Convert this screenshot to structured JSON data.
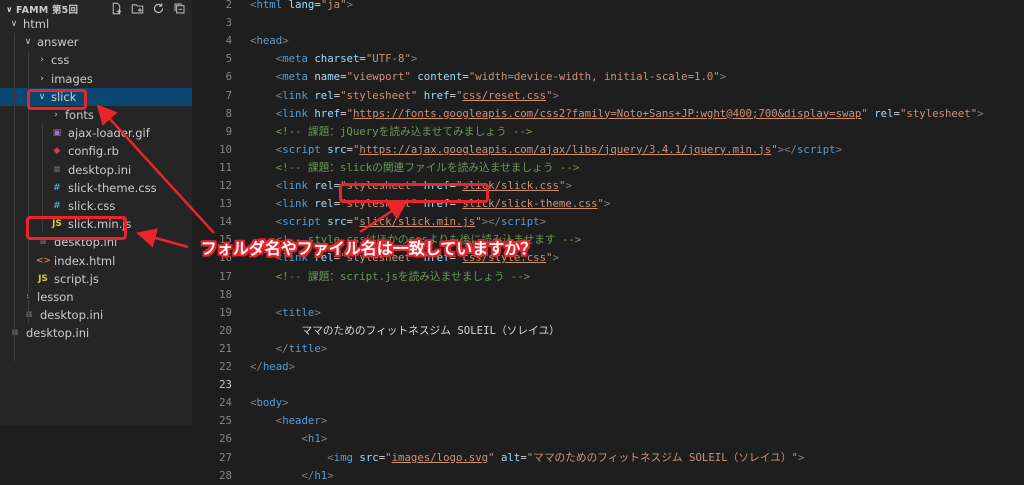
{
  "explorer": {
    "title": "FAMM 第5回",
    "items": [
      {
        "label": "html",
        "kind": "folder-open",
        "depth": 0
      },
      {
        "label": "answer",
        "kind": "folder-open",
        "depth": 1
      },
      {
        "label": "css",
        "kind": "folder-closed",
        "depth": 2
      },
      {
        "label": "images",
        "kind": "folder-closed",
        "depth": 2
      },
      {
        "label": "slick",
        "kind": "folder-open",
        "depth": 2,
        "selected": true
      },
      {
        "label": "fonts",
        "kind": "folder-closed",
        "depth": 3
      },
      {
        "label": "ajax-loader.gif",
        "kind": "image",
        "depth": 3
      },
      {
        "label": "config.rb",
        "kind": "ruby",
        "depth": 3
      },
      {
        "label": "desktop.ini",
        "kind": "settings",
        "depth": 3
      },
      {
        "label": "slick-theme.css",
        "kind": "css",
        "depth": 3
      },
      {
        "label": "slick.css",
        "kind": "css",
        "depth": 3
      },
      {
        "label": "slick.min.js",
        "kind": "js",
        "depth": 3
      },
      {
        "label": "desktop.ini",
        "kind": "settings",
        "depth": 2
      },
      {
        "label": "index.html",
        "kind": "html",
        "depth": 2
      },
      {
        "label": "script.js",
        "kind": "js",
        "depth": 2
      },
      {
        "label": "lesson",
        "kind": "folder-closed",
        "depth": 1
      },
      {
        "label": "desktop.ini",
        "kind": "settings",
        "depth": 1
      },
      {
        "label": "desktop.ini",
        "kind": "settings",
        "depth": 0
      }
    ]
  },
  "icons": {
    "css": "#",
    "js": "JS",
    "html": "<>",
    "settings": "≡",
    "ruby": "◆",
    "image": "▣",
    "chevron_open": "∨",
    "chevron_closed": "›"
  },
  "editor": {
    "lines": [
      {
        "num": "2",
        "tokens": [
          [
            "p",
            "<"
          ],
          [
            "tag",
            "html"
          ],
          [
            "t",
            " "
          ],
          [
            "attr",
            "lang"
          ],
          [
            "eq",
            "="
          ],
          [
            "val",
            "\"ja\""
          ],
          [
            "p",
            ">"
          ]
        ]
      },
      {
        "num": "3",
        "tokens": []
      },
      {
        "num": "4",
        "tokens": [
          [
            "p",
            "<"
          ],
          [
            "tag",
            "head"
          ],
          [
            "p",
            ">"
          ]
        ]
      },
      {
        "num": "5",
        "tokens": [
          [
            "t",
            "    "
          ],
          [
            "p",
            "<"
          ],
          [
            "tag",
            "meta"
          ],
          [
            "t",
            " "
          ],
          [
            "attr",
            "charset"
          ],
          [
            "eq",
            "="
          ],
          [
            "val",
            "\"UTF-8\""
          ],
          [
            "p",
            ">"
          ]
        ]
      },
      {
        "num": "6",
        "tokens": [
          [
            "t",
            "    "
          ],
          [
            "p",
            "<"
          ],
          [
            "tag",
            "meta"
          ],
          [
            "t",
            " "
          ],
          [
            "attr",
            "name"
          ],
          [
            "eq",
            "="
          ],
          [
            "val",
            "\"viewport\""
          ],
          [
            "t",
            " "
          ],
          [
            "attr",
            "content"
          ],
          [
            "eq",
            "="
          ],
          [
            "val",
            "\"width=device-width, initial-scale=1.0\""
          ],
          [
            "p",
            ">"
          ]
        ]
      },
      {
        "num": "7",
        "tokens": [
          [
            "t",
            "    "
          ],
          [
            "p",
            "<"
          ],
          [
            "tag",
            "link"
          ],
          [
            "t",
            " "
          ],
          [
            "attr",
            "rel"
          ],
          [
            "eq",
            "="
          ],
          [
            "val",
            "\"stylesheet\""
          ],
          [
            "t",
            " "
          ],
          [
            "attr",
            "href"
          ],
          [
            "eq",
            "="
          ],
          [
            "val",
            "\""
          ],
          [
            "link",
            "css/reset.css"
          ],
          [
            "val",
            "\""
          ],
          [
            "p",
            ">"
          ]
        ]
      },
      {
        "num": "8",
        "tokens": [
          [
            "t",
            "    "
          ],
          [
            "p",
            "<"
          ],
          [
            "tag",
            "link"
          ],
          [
            "t",
            " "
          ],
          [
            "attr",
            "href"
          ],
          [
            "eq",
            "="
          ],
          [
            "val",
            "\""
          ],
          [
            "link",
            "https://fonts.googleapis.com/css2?family=Noto+Sans+JP:wght@400;700&display=swap"
          ],
          [
            "val",
            "\""
          ],
          [
            "t",
            " "
          ],
          [
            "attr",
            "rel"
          ],
          [
            "eq",
            "="
          ],
          [
            "val",
            "\"stylesheet\""
          ],
          [
            "p",
            ">"
          ]
        ]
      },
      {
        "num": "9",
        "tokens": [
          [
            "t",
            "    "
          ],
          [
            "c",
            "<!-- 課題：jQueryを読み込ませてみましょう -->"
          ]
        ]
      },
      {
        "num": "10",
        "tokens": [
          [
            "t",
            "    "
          ],
          [
            "p",
            "<"
          ],
          [
            "tag",
            "script"
          ],
          [
            "t",
            " "
          ],
          [
            "attr",
            "src"
          ],
          [
            "eq",
            "="
          ],
          [
            "val",
            "\""
          ],
          [
            "link",
            "https://ajax.googleapis.com/ajax/libs/jquery/3.4.1/jquery.min.js"
          ],
          [
            "val",
            "\""
          ],
          [
            "p",
            "></"
          ],
          [
            "tag",
            "script"
          ],
          [
            "p",
            ">"
          ]
        ]
      },
      {
        "num": "11",
        "tokens": [
          [
            "t",
            "    "
          ],
          [
            "c",
            "<!-- 課題：slickの関連ファイルを読み込ませましょう -->"
          ]
        ]
      },
      {
        "num": "12",
        "tokens": [
          [
            "t",
            "    "
          ],
          [
            "p",
            "<"
          ],
          [
            "tag",
            "link"
          ],
          [
            "t",
            " "
          ],
          [
            "attr",
            "rel"
          ],
          [
            "eq",
            "="
          ],
          [
            "val",
            "\"stylesheet\""
          ],
          [
            "t",
            " "
          ],
          [
            "attr",
            "href"
          ],
          [
            "eq",
            "="
          ],
          [
            "val",
            "\""
          ],
          [
            "link",
            "slick/slick.css"
          ],
          [
            "val",
            "\""
          ],
          [
            "p",
            ">"
          ]
        ]
      },
      {
        "num": "13",
        "tokens": [
          [
            "t",
            "    "
          ],
          [
            "p",
            "<"
          ],
          [
            "tag",
            "link"
          ],
          [
            "t",
            " "
          ],
          [
            "attr",
            "rel"
          ],
          [
            "eq",
            "="
          ],
          [
            "val",
            "\"stylesheet\""
          ],
          [
            "t",
            " "
          ],
          [
            "attr",
            "href"
          ],
          [
            "eq",
            "="
          ],
          [
            "val",
            "\""
          ],
          [
            "link",
            "slick/slick-theme.css"
          ],
          [
            "val",
            "\""
          ],
          [
            "p",
            ">"
          ]
        ]
      },
      {
        "num": "14",
        "tokens": [
          [
            "t",
            "    "
          ],
          [
            "p",
            "<"
          ],
          [
            "tag",
            "script"
          ],
          [
            "t",
            " "
          ],
          [
            "attr",
            "src"
          ],
          [
            "eq",
            "="
          ],
          [
            "val",
            "\""
          ],
          [
            "link",
            "slick/slick.min.js"
          ],
          [
            "val",
            "\""
          ],
          [
            "p",
            "></"
          ],
          [
            "tag",
            "script"
          ],
          [
            "p",
            ">"
          ]
        ]
      },
      {
        "num": "15",
        "tokens": [
          [
            "t",
            "    "
          ],
          [
            "c",
            "<!-- style.cssはほかのcssよりも後に読み込ませます -->"
          ]
        ]
      },
      {
        "num": "16",
        "tokens": [
          [
            "t",
            "    "
          ],
          [
            "p",
            "<"
          ],
          [
            "tag",
            "link"
          ],
          [
            "t",
            " "
          ],
          [
            "attr",
            "rel"
          ],
          [
            "eq",
            "="
          ],
          [
            "val",
            "\"stylesheet\""
          ],
          [
            "t",
            " "
          ],
          [
            "attr",
            "href"
          ],
          [
            "eq",
            "="
          ],
          [
            "val",
            "\""
          ],
          [
            "link",
            "css/style.css"
          ],
          [
            "val",
            "\""
          ],
          [
            "p",
            ">"
          ]
        ]
      },
      {
        "num": "17",
        "tokens": [
          [
            "t",
            "    "
          ],
          [
            "c",
            "<!-- 課題：script.jsを読み込ませましょう -->"
          ]
        ]
      },
      {
        "num": "18",
        "tokens": []
      },
      {
        "num": "19",
        "tokens": [
          [
            "t",
            "    "
          ],
          [
            "p",
            "<"
          ],
          [
            "tag",
            "title"
          ],
          [
            "p",
            ">"
          ]
        ]
      },
      {
        "num": "20",
        "tokens": [
          [
            "t",
            "        "
          ],
          [
            "t",
            "ママのためのフィットネスジム SOLEIL（ソレイユ）"
          ]
        ]
      },
      {
        "num": "21",
        "tokens": [
          [
            "t",
            "    "
          ],
          [
            "p",
            "</"
          ],
          [
            "tag",
            "title"
          ],
          [
            "p",
            ">"
          ]
        ]
      },
      {
        "num": "22",
        "tokens": [
          [
            "p",
            "</"
          ],
          [
            "tag",
            "head"
          ],
          [
            "p",
            ">"
          ]
        ]
      },
      {
        "num": "23",
        "tokens": [],
        "active": true
      },
      {
        "num": "24",
        "tokens": [
          [
            "p",
            "<"
          ],
          [
            "tag",
            "body"
          ],
          [
            "p",
            ">"
          ]
        ]
      },
      {
        "num": "25",
        "tokens": [
          [
            "t",
            "    "
          ],
          [
            "p",
            "<"
          ],
          [
            "tag",
            "header"
          ],
          [
            "p",
            ">"
          ]
        ]
      },
      {
        "num": "26",
        "tokens": [
          [
            "t",
            "        "
          ],
          [
            "p",
            "<"
          ],
          [
            "tag",
            "h1"
          ],
          [
            "p",
            ">"
          ]
        ]
      },
      {
        "num": "27",
        "tokens": [
          [
            "t",
            "            "
          ],
          [
            "p",
            "<"
          ],
          [
            "tag",
            "img"
          ],
          [
            "t",
            " "
          ],
          [
            "attr",
            "src"
          ],
          [
            "eq",
            "="
          ],
          [
            "val",
            "\""
          ],
          [
            "link",
            "images/logo.svg"
          ],
          [
            "val",
            "\""
          ],
          [
            "t",
            " "
          ],
          [
            "attr",
            "alt"
          ],
          [
            "eq",
            "="
          ],
          [
            "val",
            "\"ママのためのフィットネスジム SOLEIL（ソレイユ）\""
          ],
          [
            "p",
            ">"
          ]
        ]
      },
      {
        "num": "28",
        "tokens": [
          [
            "t",
            "        "
          ],
          [
            "p",
            "</"
          ],
          [
            "tag",
            "h1"
          ],
          [
            "p",
            ">"
          ]
        ]
      }
    ]
  },
  "annotation": {
    "callout": "フォルダ名やファイル名は一致していますか？",
    "color": "#e8242c"
  }
}
